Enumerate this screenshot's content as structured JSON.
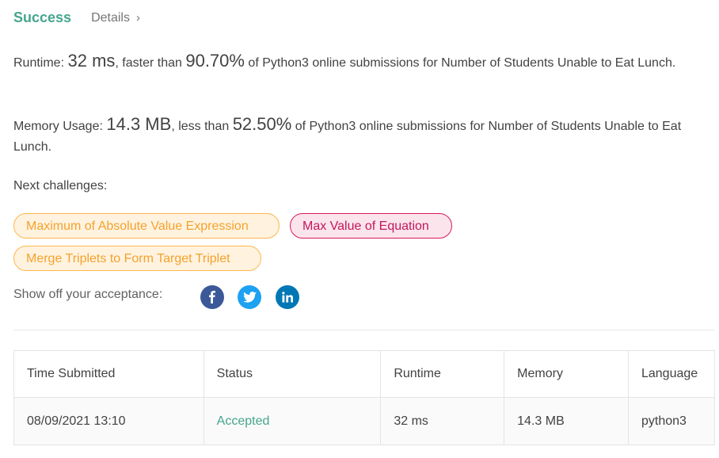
{
  "header": {
    "status": "Success",
    "details": "Details"
  },
  "runtime": {
    "label": "Runtime:",
    "value": "32 ms",
    "comparison": ", faster than ",
    "percent": "90.70%",
    "suffix": "of Python3 online submissions for Number of Students Unable to Eat Lunch."
  },
  "memory": {
    "label": "Memory Usage:",
    "value": "14.3 MB",
    "comparison": ", less than ",
    "percent": "52.50%",
    "suffix": "of Python3 online submissions for Number of Students Unable to Eat Lunch."
  },
  "next": {
    "label": "Next challenges:",
    "challenges": [
      {
        "title": "Maximum of Absolute Value Expression",
        "difficulty": "medium"
      },
      {
        "title": "Max Value of Equation",
        "difficulty": "hard"
      },
      {
        "title": "Merge Triplets to Form Target Triplet",
        "difficulty": "medium"
      }
    ]
  },
  "share": {
    "label": "Show off your acceptance:",
    "icons": [
      "facebook-icon",
      "twitter-icon",
      "linkedin-icon"
    ]
  },
  "table": {
    "headers": [
      "Time Submitted",
      "Status",
      "Runtime",
      "Memory",
      "Language"
    ],
    "rows": [
      [
        "08/09/2021 13:10",
        "Accepted",
        "32 ms",
        "14.3 MB",
        "python3"
      ]
    ]
  },
  "colors": {
    "success": "#45a58d",
    "medium": "#f5a12b",
    "hard": "#c2185b",
    "facebook": "#3b5998",
    "twitter": "#1da1f2",
    "linkedin": "#0077b5"
  }
}
